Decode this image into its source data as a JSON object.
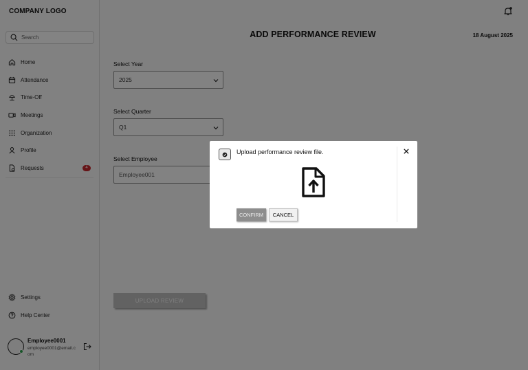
{
  "sidebar": {
    "logo": "COMPANY LOGO",
    "search_placeholder": "Search",
    "nav": [
      {
        "label": "Home",
        "icon": "home-icon"
      },
      {
        "label": "Attendance",
        "icon": "calendar-icon"
      },
      {
        "label": "Time-Off",
        "icon": "beach-icon"
      },
      {
        "label": "Meetings",
        "icon": "video-icon"
      },
      {
        "label": "Organization",
        "icon": "grid-icon"
      },
      {
        "label": "Profile",
        "icon": "user-icon"
      },
      {
        "label": "Requests",
        "icon": "document-icon",
        "badge": "4"
      }
    ],
    "bottom": [
      {
        "label": "Settings",
        "icon": "gear-icon"
      },
      {
        "label": "Help Center",
        "icon": "help-icon"
      }
    ],
    "user": {
      "name": "Employee0001",
      "email": "employee0001@email.com"
    }
  },
  "main": {
    "title": "ADD PERFORMANCE REVIEW",
    "date": "18 August 2025",
    "year_label": "Select Year",
    "year_value": "2025",
    "quarter_label": "Select Quarter",
    "quarter_value": "Q1",
    "employee_label": "Select Employee",
    "employee_value": "Employee001",
    "upload_button": "UPLOAD REVIEW"
  },
  "modal": {
    "title": "Upload performance review file.",
    "confirm": "CONFIRM",
    "cancel": "CANCEL"
  },
  "colors": {
    "badge": "#c0262c",
    "online": "#2e9d4c",
    "overlay": "rgba(0,0,0,0.47)"
  }
}
